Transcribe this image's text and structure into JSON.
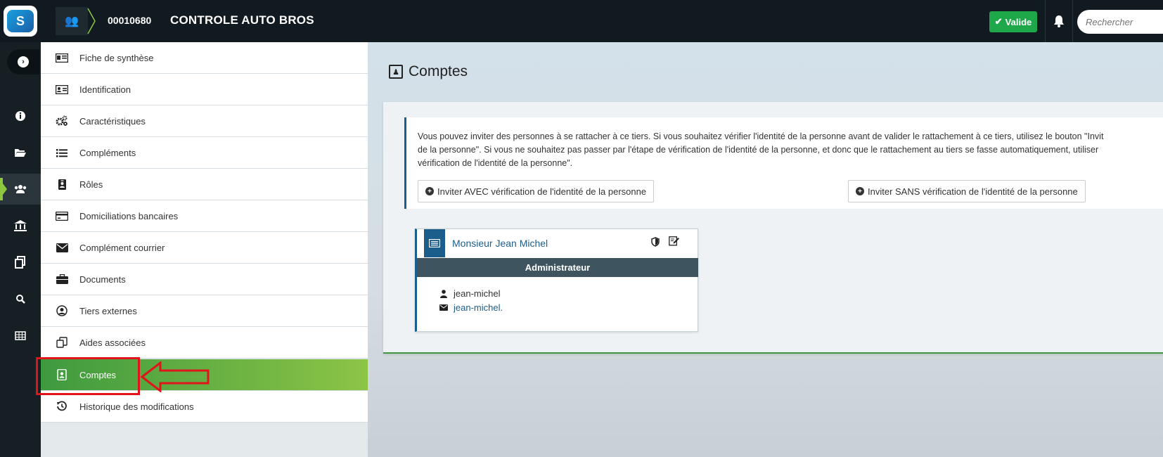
{
  "header": {
    "logo_text": "S",
    "breadcrumb_id": "00010680",
    "breadcrumb_name": "CONTROLE AUTO BROS",
    "status_label": "Valide",
    "search_placeholder": "Rechercher"
  },
  "rail": {
    "icons": [
      "chevron-right-icon",
      "info-icon",
      "folder-icon",
      "users-icon",
      "bank-icon",
      "documents-icon",
      "search-icon",
      "table-icon"
    ],
    "active_index": 3
  },
  "menu": {
    "items": [
      {
        "label": "Fiche de synthèse",
        "icon": "id-card-icon"
      },
      {
        "label": "Identification",
        "icon": "address-card-icon"
      },
      {
        "label": "Caractéristiques",
        "icon": "cogs-icon"
      },
      {
        "label": "Compléments",
        "icon": "list-icon"
      },
      {
        "label": "Rôles",
        "icon": "id-badge-icon"
      },
      {
        "label": "Domiciliations bancaires",
        "icon": "credit-card-icon"
      },
      {
        "label": "Complément courrier",
        "icon": "envelope-icon"
      },
      {
        "label": "Documents",
        "icon": "briefcase-icon"
      },
      {
        "label": "Tiers externes",
        "icon": "user-circle-icon"
      },
      {
        "label": "Aides associées",
        "icon": "copy-icon"
      },
      {
        "label": "Comptes",
        "icon": "contact-book-icon"
      },
      {
        "label": "Historique des modifications",
        "icon": "history-icon"
      }
    ],
    "active_index": 10
  },
  "main": {
    "title": "Comptes",
    "info_lines": [
      "Vous pouvez inviter des personnes à se rattacher à ce tiers. Si vous souhaitez vérifier l'identité de la personne avant de valider le rattachement à ce tiers, utilisez le bouton \"Invit",
      "de la personne\". Si vous ne souhaitez pas passer par l'étape de vérification de l'identité de la personne, et donc que le rattachement au tiers se fasse automatiquement, utiliser",
      "vérification de l'identité de la personne\"."
    ],
    "invite_with_label": "Inviter AVEC vérification de l'identité de la personne",
    "invite_without_label": "Inviter SANS vérification de l'identité de la personne",
    "card": {
      "name": "Monsieur  Jean Michel",
      "role": "Administrateur",
      "username": "jean-michel",
      "email": "jean-michel."
    }
  },
  "colors": {
    "accent_green": "#8dc63f",
    "valid_green": "#1ea84a",
    "primary_blue": "#1b5e8c",
    "annotation_red": "#e0141a"
  }
}
